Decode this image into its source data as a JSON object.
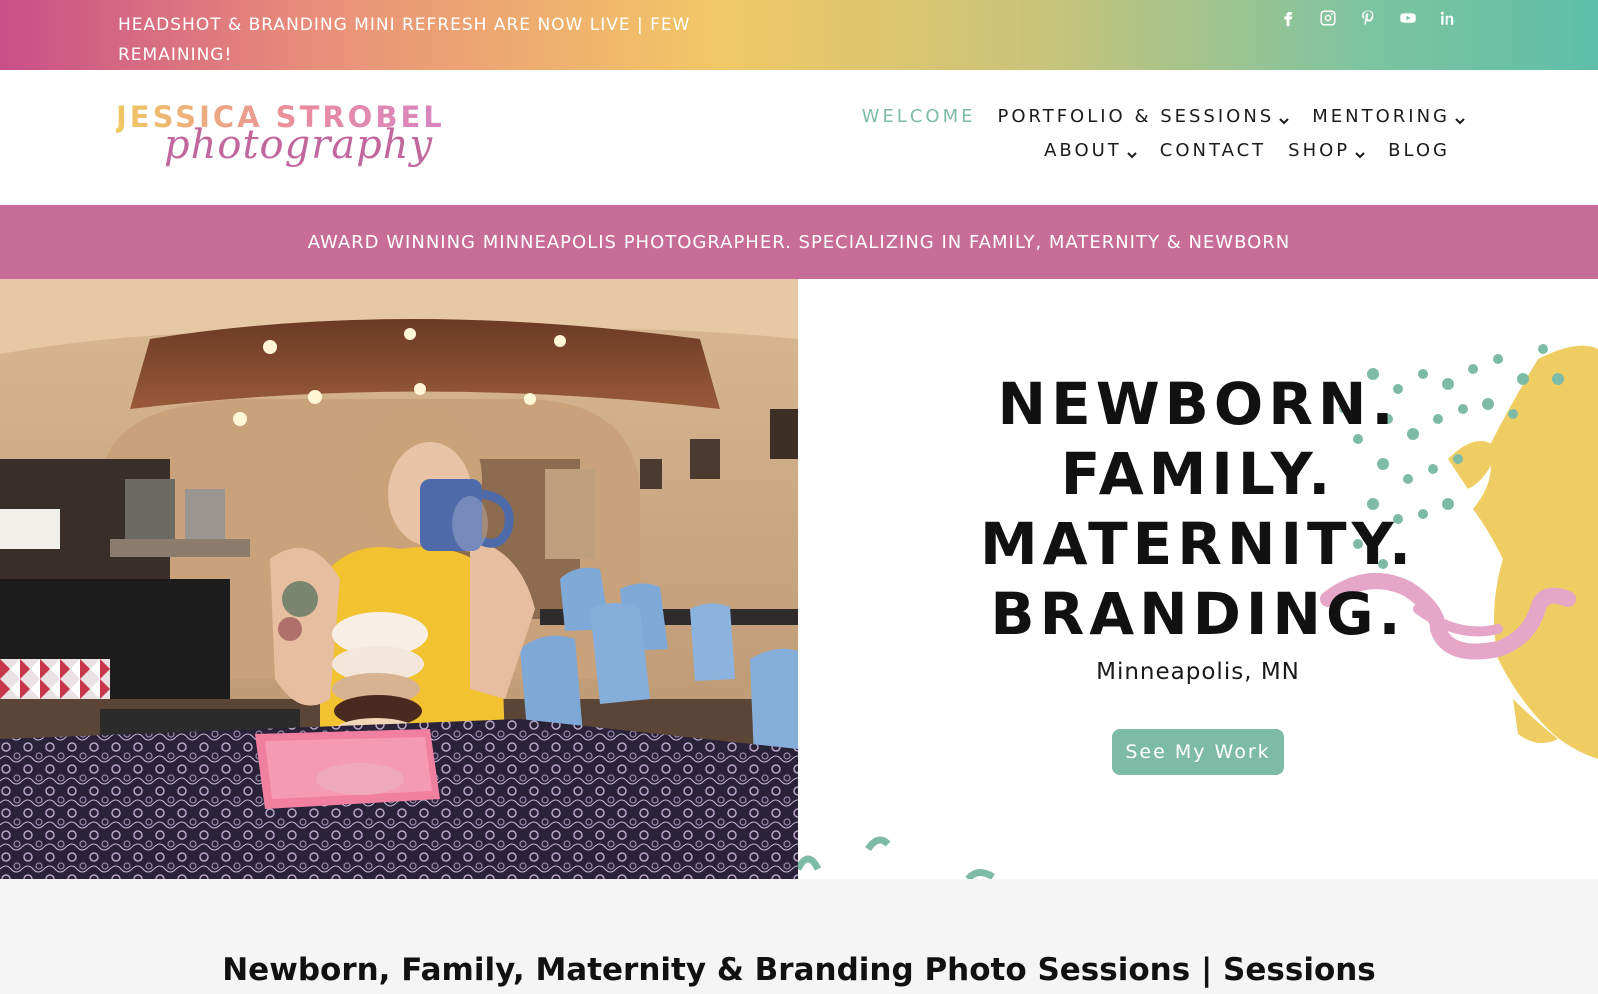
{
  "topbar": {
    "announcement": "HEADSHOT & BRANDING MINI REFRESH ARE NOW LIVE | FEW REMAINING!",
    "social": [
      {
        "icon": "facebook-icon"
      },
      {
        "icon": "instagram-icon"
      },
      {
        "icon": "pinterest-icon"
      },
      {
        "icon": "youtube-icon"
      },
      {
        "icon": "linkedin-icon"
      }
    ]
  },
  "logo": {
    "line1": "JESSICA STROBEL",
    "line2": "photography"
  },
  "nav": {
    "welcome": "WELCOME",
    "portfolio": "PORTFOLIO & SESSIONS",
    "mentoring": "MENTORING",
    "about": "ABOUT",
    "contact": "CONTACT",
    "shop": "SHOP",
    "blog": "BLOG"
  },
  "banner": {
    "text": "AWARD WINNING MINNEAPOLIS PHOTOGRAPHER. SPECIALIZING IN FAMILY, MATERNITY & NEWBORN"
  },
  "hero": {
    "line1": "NEWBORN.",
    "line2": "FAMILY.",
    "line3": "MATERNITY.",
    "line4": "BRANDING.",
    "subtitle": "Minneapolis, MN",
    "button": "See My Work"
  },
  "section2": {
    "title": "Newborn, Family, Maternity & Branding Photo Sessions | Sessions"
  },
  "colors": {
    "accent_teal": "#7dbba6",
    "banner_pink": "#c76d97",
    "splash_yellow": "#f0cd62",
    "splash_pink": "#e6a6c7"
  }
}
